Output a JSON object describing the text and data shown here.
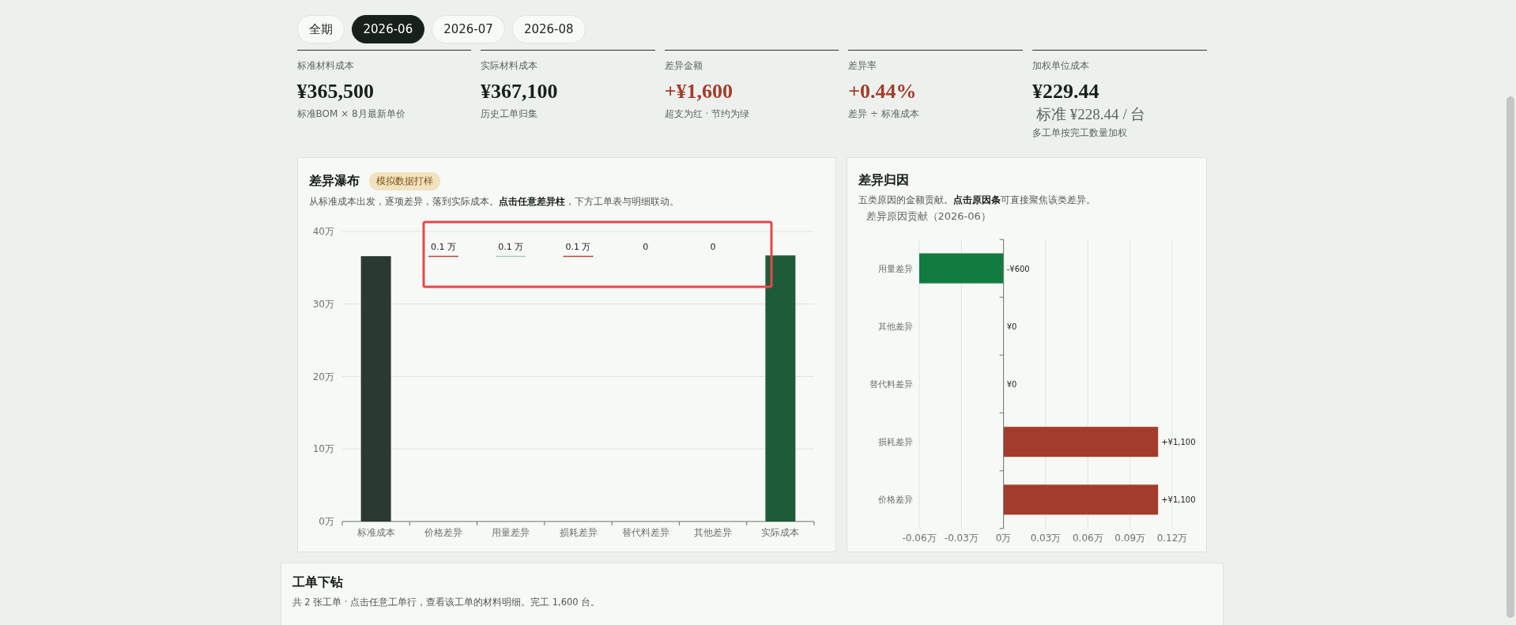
{
  "period_tabs": [
    {
      "label": "全期",
      "selected": false
    },
    {
      "label": "2026-06",
      "selected": true
    },
    {
      "label": "2026-07",
      "selected": false
    },
    {
      "label": "2026-08",
      "selected": false
    }
  ],
  "kpis": [
    {
      "label": "标准材料成本",
      "value": "¥365,500",
      "color": "#17201a",
      "note": "标准BOM × 8月最新单价"
    },
    {
      "label": "实际材料成本",
      "value": "¥367,100",
      "color": "#17201a",
      "note": "历史工单归集"
    },
    {
      "label": "差异金额",
      "value": "+¥1,600",
      "color": "#a63c2b",
      "note": "超支为红 · 节约为绿"
    },
    {
      "label": "差异率",
      "value": "+0.44%",
      "color": "#a63c2b",
      "note": "差异 ÷ 标准成本"
    },
    {
      "label": "加权单位成本",
      "value": "¥229.44",
      "standard": "标准 ¥228.44",
      "unit": "/ 台",
      "color": "#17201a",
      "note": "多工单按完工数量加权"
    }
  ],
  "waterfall": {
    "title": "差异瀑布",
    "badge": "模拟数据打样",
    "description": "从标准成本出发，逐项差异，落到实际成本。**点击任意差异柱**，下方工单表与明细联动。",
    "chart_data": {
      "type": "bar",
      "categories": [
        "标准成本",
        "价格差异",
        "用量差异",
        "损耗差异",
        "替代料差异",
        "其他差异",
        "实际成本"
      ],
      "values": [
        36.6,
        null,
        null,
        null,
        null,
        null,
        36.7
      ],
      "ylim": [
        0,
        40
      ],
      "yticks": [
        {
          "value": 0,
          "label": "0万"
        },
        {
          "value": 10,
          "label": "10万"
        },
        {
          "value": 20,
          "label": "20万"
        },
        {
          "value": 30,
          "label": "30万"
        },
        {
          "value": 40,
          "label": "40万"
        }
      ],
      "grid": true
    },
    "steps": [
      {
        "kind": "start"
      },
      {
        "kind": "up",
        "label": "0.1 万"
      },
      {
        "kind": "down",
        "label": "0.1 万"
      },
      {
        "kind": "up",
        "label": "0.1 万"
      },
      {
        "kind": "flat",
        "label": "0"
      },
      {
        "kind": "flat",
        "label": "0"
      },
      {
        "kind": "end"
      }
    ]
  },
  "attribution": {
    "title": "差异归因",
    "description": "五类原因的金额贡献。**点击原因条**可直接聚焦该类差异。",
    "chart_data": {
      "type": "bar",
      "orientation": "horizontal",
      "title": "差异原因贡献（2026-06）",
      "categories": [
        "用量差异",
        "其他差异",
        "替代料差异",
        "损耗差异",
        "价格差异"
      ],
      "values": [
        -0.06,
        0,
        0,
        0.11,
        0.11
      ],
      "xlim": [
        -0.06,
        0.12
      ],
      "xticks": [
        {
          "value": -0.06,
          "label": "-0.06万"
        },
        {
          "value": -0.03,
          "label": "-0.03万"
        },
        {
          "value": 0,
          "label": "0万"
        },
        {
          "value": 0.03,
          "label": "0.03万"
        },
        {
          "value": 0.06,
          "label": "0.06万"
        },
        {
          "value": 0.09,
          "label": "0.09万"
        },
        {
          "value": 0.12,
          "label": "0.12万"
        }
      ],
      "grid": true
    },
    "bar_labels": [
      "-¥600",
      "¥0",
      "¥0",
      "+¥1,100",
      "+¥1,100"
    ]
  },
  "drilldown": {
    "title": "工单下钻",
    "description": "共 2 张工单 · 点击任意工单行，查看该工单的材料明细。完工 1,600 台。"
  }
}
